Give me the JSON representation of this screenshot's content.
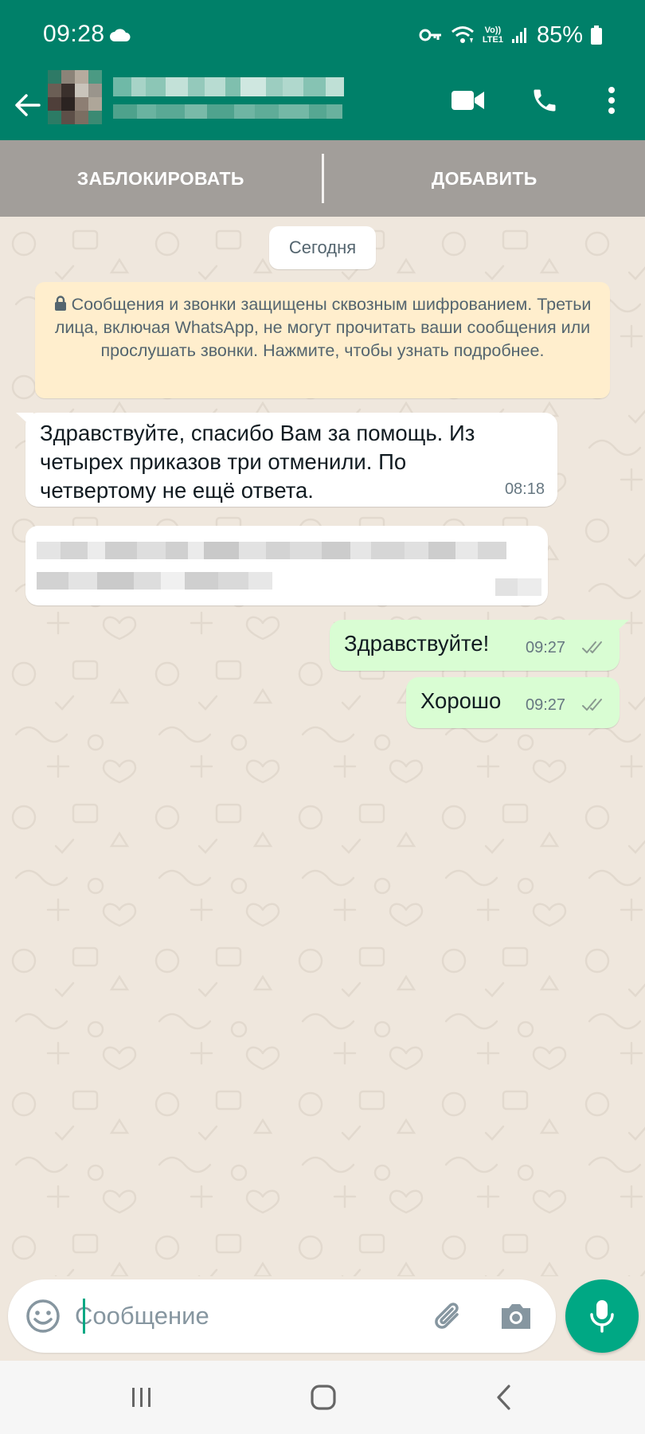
{
  "status_bar": {
    "time": "09:28",
    "battery": "85%",
    "network_label": "LTE1",
    "volte_label": "Vo))"
  },
  "header": {
    "contact_name": "",
    "icons": [
      "back-arrow-icon",
      "video-call-icon",
      "phone-icon",
      "more-vert-icon"
    ],
    "accent_color": "#008069"
  },
  "action_bar": {
    "block_label": "ЗАБЛОКИРОВАТЬ",
    "add_label": "ДОБАВИТЬ"
  },
  "chat": {
    "date_chip": "Сегодня",
    "encryption_notice": "Сообщения и звонки защищены сквозным шифрованием. Третьи лица, включая WhatsApp, не могут прочитать ваши сообщения или прослушать звонки. Нажмите, чтобы узнать подробнее.",
    "messages": [
      {
        "direction": "incoming",
        "text": "Здравствуйте, спасибо Вам за помощь. Из четырех приказов три отменили. По четвертому не ещё ответа.",
        "time": "08:18"
      },
      {
        "direction": "incoming",
        "text": "",
        "time": ""
      },
      {
        "direction": "outgoing",
        "text": "Здравствуйте!",
        "time": "09:27",
        "status": "read"
      },
      {
        "direction": "outgoing",
        "text": "Хорошо",
        "time": "09:27",
        "status": "read"
      }
    ],
    "bubble_colors": {
      "incoming": "#ffffff",
      "outgoing": "#d9fdd3"
    }
  },
  "composer": {
    "placeholder": "Сообщение",
    "icons": [
      "emoji-icon",
      "paperclip-icon",
      "camera-icon",
      "microphone-icon"
    ],
    "send_color": "#00a884"
  },
  "navigation": {
    "icons": [
      "recent-apps-icon",
      "home-icon",
      "back-icon"
    ]
  }
}
